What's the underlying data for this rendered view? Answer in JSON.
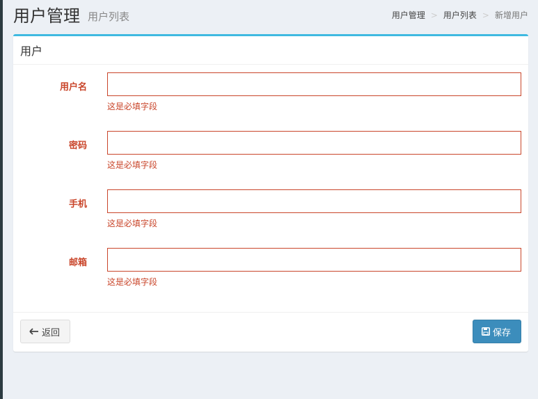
{
  "header": {
    "title": "用户管理",
    "subtitle": "用户列表"
  },
  "breadcrumb": [
    {
      "label": "用户管理"
    },
    {
      "label": "用户列表"
    },
    {
      "label": "新增用户"
    }
  ],
  "breadcrumb_separator": ">",
  "box": {
    "title": "用户",
    "accent_color": "#3fb9e0"
  },
  "form": {
    "error_color": "#c9452a",
    "fields": [
      {
        "label": "用户名",
        "value": "",
        "error": "这是必填字段"
      },
      {
        "label": "密码",
        "value": "",
        "error": "这是必填字段"
      },
      {
        "label": "手机",
        "value": "",
        "error": "这是必填字段"
      },
      {
        "label": "邮箱",
        "value": "",
        "error": "这是必填字段"
      }
    ]
  },
  "footer": {
    "back_label": "返回",
    "back_icon": "arrow-left-icon",
    "save_label": "保存",
    "save_icon": "floppy-disk-icon",
    "save_color": "#3c8dbc"
  }
}
